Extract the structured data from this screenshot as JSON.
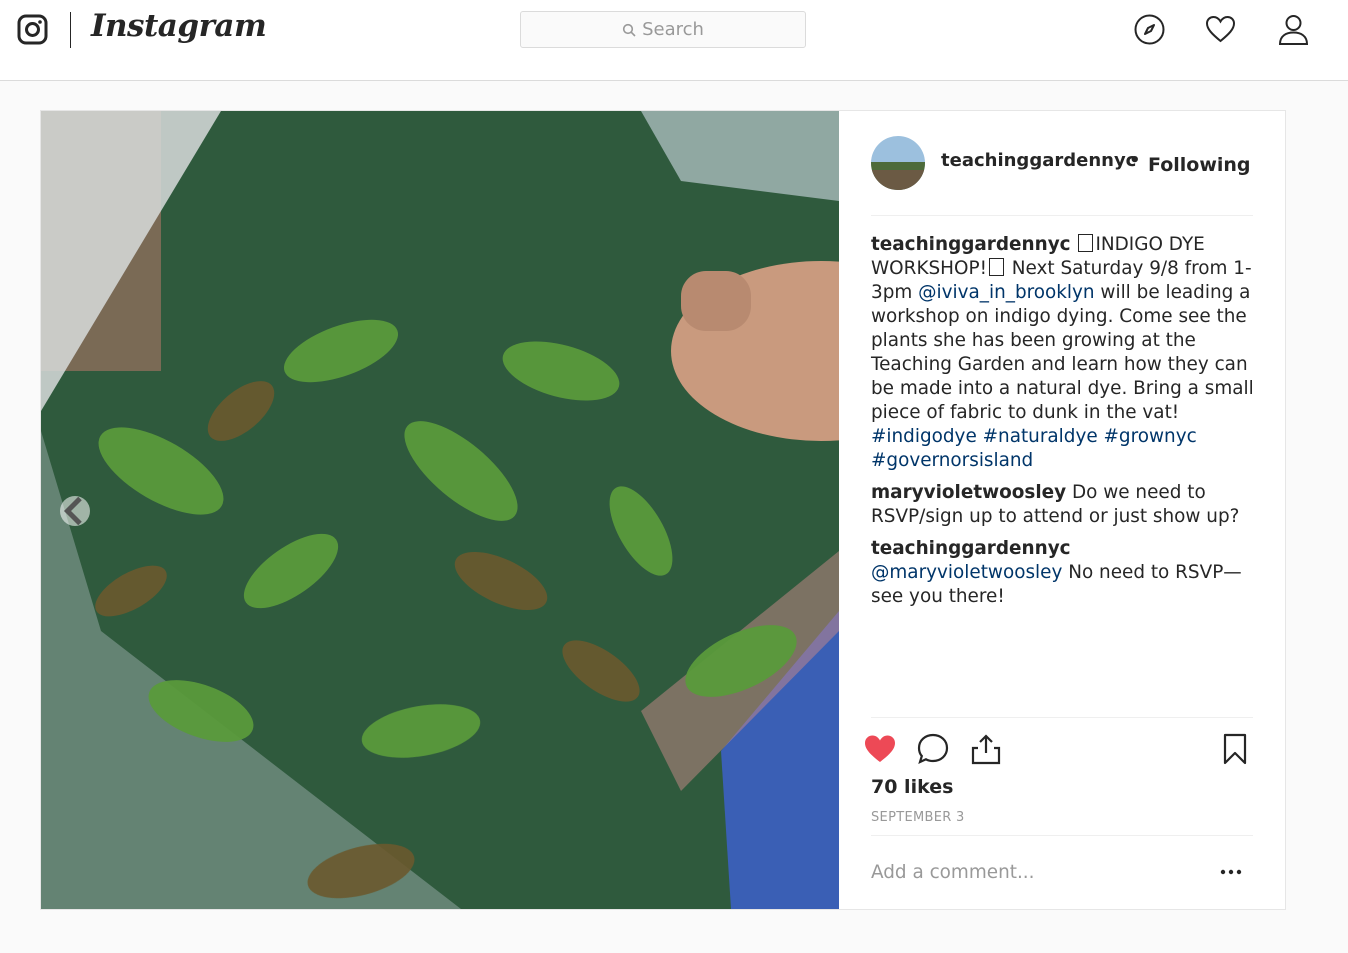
{
  "nav": {
    "brand": "Instagram",
    "search_placeholder": "Search",
    "icons": [
      "instagram-glyph-icon",
      "compass-icon",
      "heart-icon",
      "person-icon"
    ]
  },
  "post": {
    "author": "teachinggardennyc",
    "follow_separator": "•",
    "follow_state": "Following",
    "comments": [
      {
        "user": "teachinggardennyc",
        "segments": [
          {
            "type": "box"
          },
          {
            "type": "text",
            "value": "INDIGO DYE WORKSHOP!"
          },
          {
            "type": "box"
          },
          {
            "type": "text",
            "value": " Next Saturday 9/8 from 1-3pm "
          },
          {
            "type": "mention",
            "value": "@iviva_in_brooklyn"
          },
          {
            "type": "text",
            "value": " will be leading a workshop on indigo dying. Come see the plants she has been growing at the Teaching Garden and learn how they can be made into a natural dye. Bring a small piece of fabric to dunk in the vat! "
          },
          {
            "type": "mention",
            "value": "#indigodye"
          },
          {
            "type": "text",
            "value": " "
          },
          {
            "type": "mention",
            "value": "#naturaldye"
          },
          {
            "type": "text",
            "value": " "
          },
          {
            "type": "mention",
            "value": "#grownyc"
          },
          {
            "type": "text",
            "value": " "
          },
          {
            "type": "mention",
            "value": "#governorsisland"
          }
        ]
      },
      {
        "user": "maryvioletwoosley",
        "segments": [
          {
            "type": "text",
            "value": "Do we need to RSVP/sign up to attend or just show up?"
          }
        ]
      },
      {
        "user": "teachinggardennyc",
        "segments": [
          {
            "type": "mention",
            "value": "@maryvioletwoosley"
          },
          {
            "type": "text",
            "value": " No need to RSVP—see you there!"
          }
        ]
      }
    ],
    "likes": "70 likes",
    "date": "SEPTEMBER 3",
    "add_comment_placeholder": "Add a comment...",
    "liked": true,
    "colors": {
      "like": "#ed4956",
      "link": "#003569",
      "muted": "#999999"
    }
  }
}
